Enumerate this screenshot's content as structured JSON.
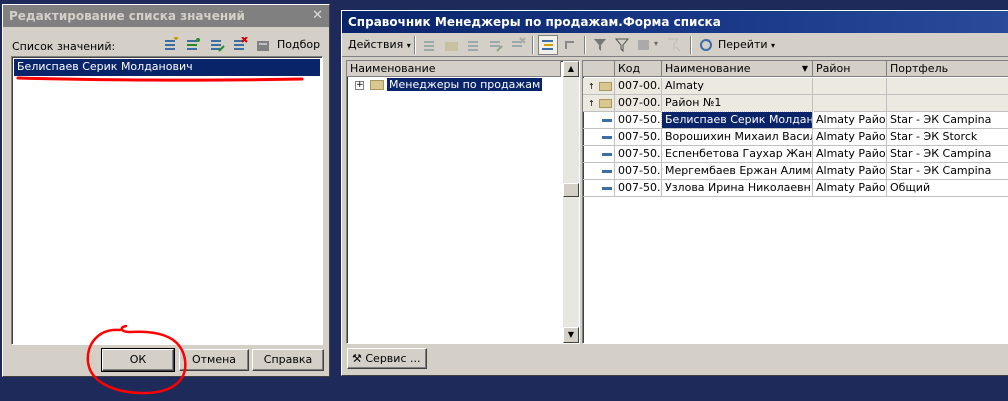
{
  "dialog": {
    "title": "Редактирование списка значений",
    "close_glyph": "✕",
    "list_label": "Список значений:",
    "selection_label": "Подбор",
    "items": [
      "Белиспаев Серик Молданович"
    ],
    "ok_label": "ОК",
    "cancel_label": "Отмена",
    "help_label": "Справка"
  },
  "main_window": {
    "title": "Справочник Менеджеры по продажам.Форма списка",
    "actions_label": "Действия",
    "goto_label": "Перейти",
    "tree": {
      "header": "Наименование",
      "root_label": "Менеджеры по продажам",
      "expand_glyph": "+"
    },
    "table": {
      "columns": [
        "Код",
        "Наименование",
        "Район",
        "Портфель"
      ],
      "rows": [
        {
          "kind": "folder",
          "code": "007-00...",
          "name": "Almaty",
          "district": "",
          "portfolio": ""
        },
        {
          "kind": "folder",
          "code": "007-00...",
          "name": "Район №1",
          "district": "",
          "portfolio": ""
        },
        {
          "kind": "item",
          "code": "007-50...",
          "name": "Белиспаев Серик Молдано...",
          "district": "Almaty Райо...",
          "portfolio": "Star - ЭК Campina"
        },
        {
          "kind": "item",
          "code": "007-50...",
          "name": "Ворошихин Михаил Василь...",
          "district": "Almaty Райо...",
          "portfolio": "Star - ЭК Storck"
        },
        {
          "kind": "item",
          "code": "007-50...",
          "name": "Еспенбетова Гаухар Жана...",
          "district": "Almaty Райо...",
          "portfolio": "Star - ЭК Campina"
        },
        {
          "kind": "item",
          "code": "007-50...",
          "name": "Мергембаев Ержан Алимг...",
          "district": "Almaty Райо...",
          "portfolio": "Star - ЭК Campina"
        },
        {
          "kind": "item",
          "code": "007-50...",
          "name": "Узлова Ирина Николаевн...",
          "district": "Almaty Райо...",
          "portfolio": "Общий"
        }
      ]
    },
    "service_label": "Сервис ..."
  },
  "colors": {
    "selection": "#0a246a",
    "annotation": "#ff0000",
    "background": "#1e2a5a"
  }
}
